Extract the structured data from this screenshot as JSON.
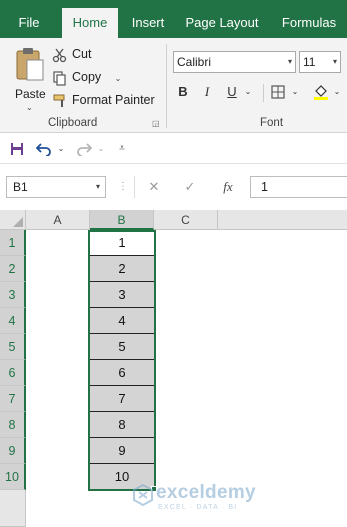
{
  "ribbon_tabs": [
    "File",
    "Home",
    "Insert",
    "Page Layout",
    "Formulas"
  ],
  "active_tab": "Home",
  "clipboard": {
    "paste_label": "Paste",
    "cut_label": "Cut",
    "copy_label": "Copy",
    "format_painter_label": "Format Painter",
    "group_label": "Clipboard"
  },
  "font_group": {
    "font_name": "Calibri",
    "font_size": "11",
    "bold": "B",
    "italic": "I",
    "underline": "U",
    "group_label": "Font"
  },
  "formula_bar": {
    "name_box": "B1",
    "fx_label": "fx",
    "formula_value": "1"
  },
  "grid": {
    "columns": [
      "A",
      "B",
      "C"
    ],
    "selected_column": "B",
    "rows": [
      "1",
      "2",
      "3",
      "4",
      "5",
      "6",
      "7",
      "8",
      "9",
      "10"
    ],
    "column_b_values": [
      "1",
      "2",
      "3",
      "4",
      "5",
      "6",
      "7",
      "8",
      "9",
      "10"
    ]
  },
  "watermark": {
    "name": "exceldemy",
    "tagline": "EXCEL · DATA · BI"
  },
  "colors": {
    "excel_green": "#217346",
    "selected_fill": "#d4d4d4"
  }
}
